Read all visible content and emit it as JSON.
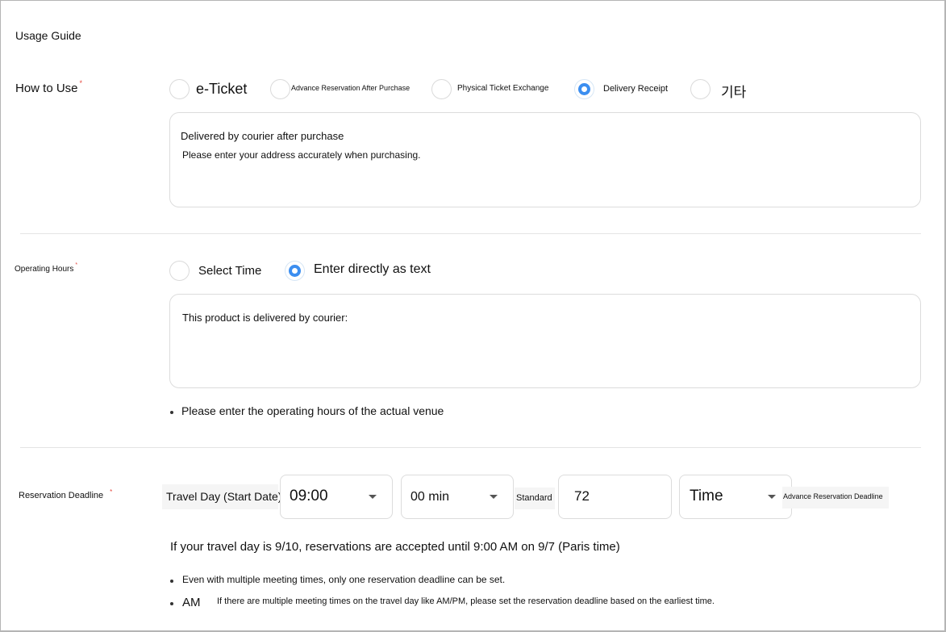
{
  "section_title": "Usage Guide",
  "required_mark": "*",
  "how_to_use": {
    "label": "How to Use",
    "options": [
      "e-Ticket",
      "Advance Reservation After Purchase",
      "Physical Ticket Exchange",
      "Delivery Receipt",
      "기타"
    ],
    "selected": "Delivery Receipt",
    "text_line1": "Delivered by courier after purchase",
    "text_line2": "Please enter your address accurately when purchasing."
  },
  "operating_hours": {
    "label": "Operating Hours",
    "options": [
      "Select Time",
      "Enter directly as text"
    ],
    "selected": "Enter directly as text",
    "text": "This product is delivered by courier:",
    "note": "Please enter the operating hours of the actual venue"
  },
  "reservation_deadline": {
    "label": "Reservation Deadline",
    "travel_day_label": "Travel Day (Start Date)",
    "hour_value": "09:00",
    "minute_value": "00 min",
    "standard_label": "Standard",
    "amount_value": "72",
    "unit_value": "Time",
    "suffix_label": "Advance Reservation Deadline",
    "example": "If your travel day is 9/10, reservations are accepted until 9:00 AM on 9/7 (Paris time)",
    "note1": "Even with multiple meeting times, only one reservation deadline can be set.",
    "note2_prefix": "AM",
    "note2": "If there are multiple meeting times on the travel day like AM/PM, please set the reservation deadline based on the earliest time."
  }
}
